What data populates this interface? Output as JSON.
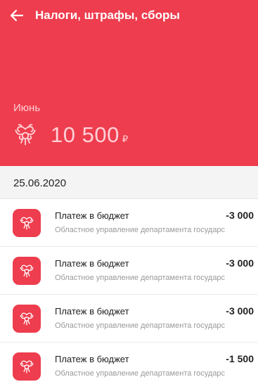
{
  "header": {
    "back_icon": "arrow-left-icon",
    "title": "Налоги, штрафы, сборы",
    "background_color": "#ee3d4e"
  },
  "summary": {
    "month": "Июнь",
    "emblem_icon": "eagle-emblem-icon",
    "amount": "10 500",
    "currency": "₽"
  },
  "date_group": {
    "date": "25.06.2020"
  },
  "transactions": [
    {
      "icon": "eagle-emblem-icon",
      "name": "Платеж в бюджет",
      "amount": "-3 000",
      "description": "Областное управление департамента государс"
    },
    {
      "icon": "eagle-emblem-icon",
      "name": "Платеж в бюджет",
      "amount": "-3 000",
      "description": "Областное управление департамента государс"
    },
    {
      "icon": "eagle-emblem-icon",
      "name": "Платеж в бюджет",
      "amount": "-3 000",
      "description": "Областное управление департамента государс"
    },
    {
      "icon": "eagle-emblem-icon",
      "name": "Платеж в бюджет",
      "amount": "-1 500",
      "description": "Областное управление департамента государс"
    }
  ]
}
